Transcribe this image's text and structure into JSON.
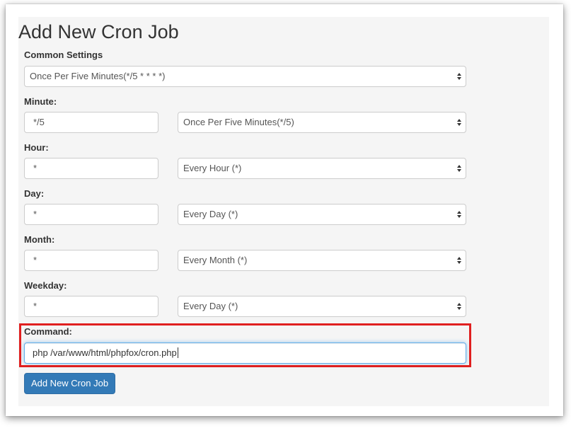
{
  "title": "Add New Cron Job",
  "common_settings": {
    "label": "Common Settings",
    "selected": "Once Per Five Minutes(*/5 * * * *)"
  },
  "fields": [
    {
      "label": "Minute:",
      "value": "*/5",
      "select": "Once Per Five Minutes(*/5)"
    },
    {
      "label": "Hour:",
      "value": "*",
      "select": "Every Hour (*)"
    },
    {
      "label": "Day:",
      "value": "*",
      "select": "Every Day (*)"
    },
    {
      "label": "Month:",
      "value": "*",
      "select": "Every Month (*)"
    },
    {
      "label": "Weekday:",
      "value": "*",
      "select": "Every Day (*)"
    }
  ],
  "command": {
    "label": "Command:",
    "value": "php /var/www/html/phpfox/cron.php"
  },
  "submit_label": "Add New Cron Job",
  "colors": {
    "primary_button": "#337ab7",
    "highlight_border": "#e02020",
    "focus_border": "#66afe9"
  }
}
